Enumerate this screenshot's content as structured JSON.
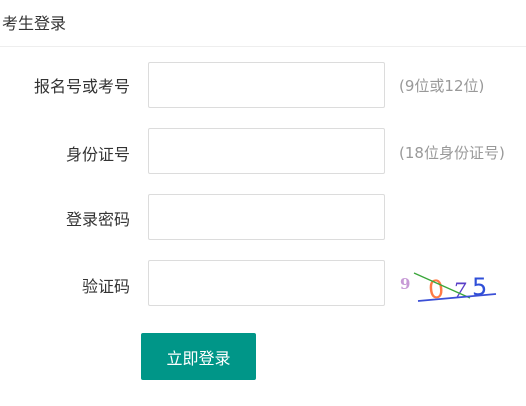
{
  "panel": {
    "title": "考生登录"
  },
  "form": {
    "reg_no": {
      "label": "报名号或考号",
      "value": "",
      "hint": "(9位或12位)"
    },
    "id_card": {
      "label": "身份证号",
      "value": "",
      "hint": "(18位身份证号)"
    },
    "password": {
      "label": "登录密码",
      "value": ""
    },
    "captcha": {
      "label": "验证码",
      "value": "",
      "image_text": "9075"
    }
  },
  "submit_label": "立即登录",
  "colors": {
    "primary": "#009688",
    "hint": "#999999",
    "border": "#dcdcdc"
  }
}
